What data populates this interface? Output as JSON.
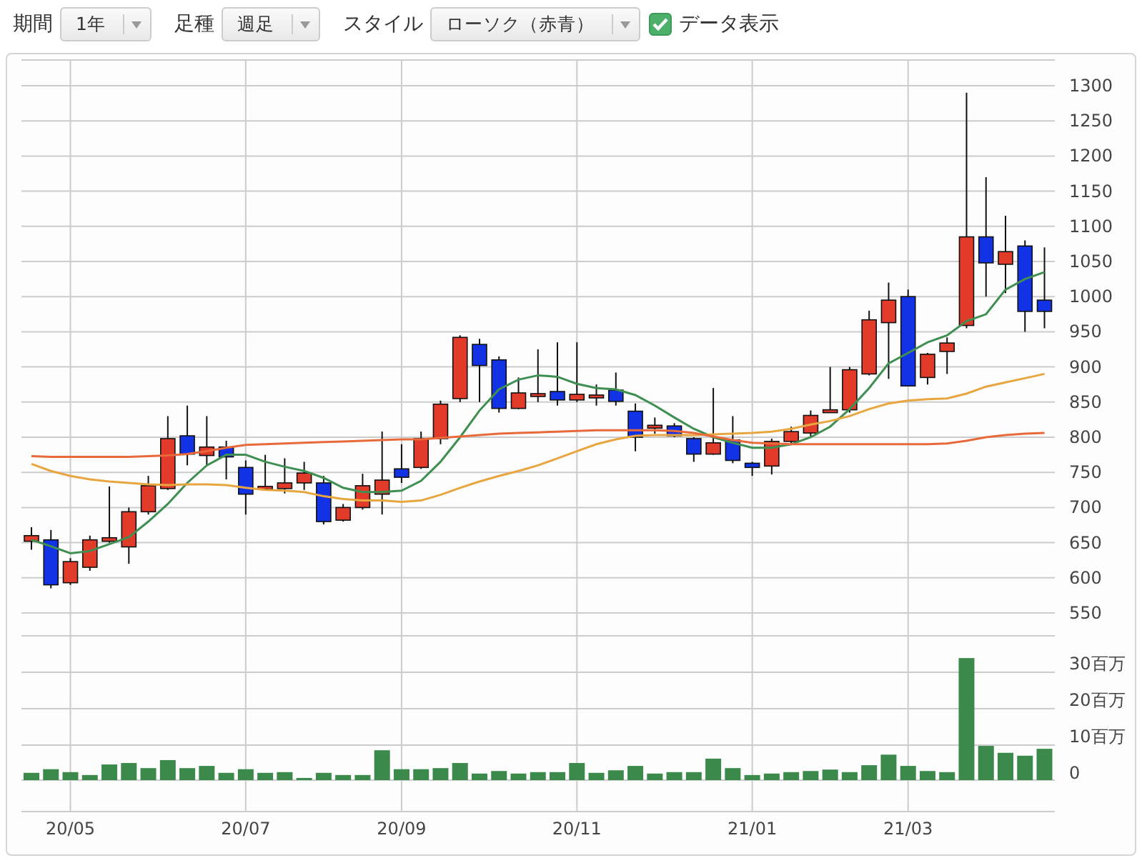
{
  "toolbar": [
    {
      "kind": "dropdown",
      "label": "期間",
      "value": "1年"
    },
    {
      "kind": "dropdown",
      "label": "足種",
      "value": "週足"
    },
    {
      "kind": "dropdown",
      "label": "スタイル",
      "value": "ローソク（赤青）"
    },
    {
      "kind": "checkbox",
      "label": "データ表示",
      "checked": true
    }
  ],
  "price_chart": {
    "chart_data": {
      "type": "candlestick",
      "grid": true,
      "ylim": [
        550,
        1300
      ],
      "yticks": [
        550,
        600,
        650,
        700,
        750,
        800,
        850,
        900,
        950,
        1000,
        1050,
        1100,
        1150,
        1200,
        1250,
        1300
      ],
      "ohlc": [
        [
          652,
          672,
          640,
          660
        ],
        [
          654,
          668,
          585,
          590
        ],
        [
          593,
          628,
          590,
          623
        ],
        [
          615,
          660,
          610,
          654
        ],
        [
          652,
          730,
          650,
          657
        ],
        [
          644,
          700,
          620,
          694
        ],
        [
          694,
          745,
          690,
          731
        ],
        [
          727,
          830,
          725,
          798
        ],
        [
          802,
          845,
          760,
          776
        ],
        [
          774,
          830,
          760,
          786
        ],
        [
          786,
          795,
          740,
          772
        ],
        [
          757,
          767,
          690,
          719
        ],
        [
          728,
          775,
          725,
          730
        ],
        [
          727,
          770,
          720,
          735
        ],
        [
          735,
          765,
          725,
          749
        ],
        [
          735,
          745,
          676,
          680
        ],
        [
          682,
          705,
          680,
          700
        ],
        [
          700,
          748,
          697,
          731
        ],
        [
          719,
          808,
          690,
          739
        ],
        [
          755,
          790,
          735,
          743
        ],
        [
          757,
          808,
          755,
          798
        ],
        [
          798,
          852,
          790,
          847
        ],
        [
          855,
          945,
          850,
          942
        ],
        [
          932,
          940,
          850,
          902
        ],
        [
          910,
          915,
          835,
          841
        ],
        [
          841,
          885,
          840,
          863
        ],
        [
          860,
          925,
          850,
          862
        ],
        [
          865,
          935,
          845,
          853
        ],
        [
          853,
          935,
          850,
          861
        ],
        [
          858,
          875,
          845,
          860
        ],
        [
          867,
          892,
          845,
          851
        ],
        [
          837,
          848,
          780,
          800
        ],
        [
          815,
          828,
          805,
          817
        ],
        [
          816,
          820,
          800,
          802
        ],
        [
          798,
          800,
          765,
          776
        ],
        [
          776,
          870,
          775,
          792
        ],
        [
          796,
          830,
          763,
          767
        ],
        [
          763,
          765,
          745,
          757
        ],
        [
          759,
          798,
          747,
          794
        ],
        [
          794,
          815,
          790,
          808
        ],
        [
          806,
          838,
          800,
          831
        ],
        [
          836,
          900,
          835,
          839
        ],
        [
          839,
          900,
          835,
          896
        ],
        [
          890,
          980,
          888,
          967
        ],
        [
          963,
          1020,
          883,
          995
        ],
        [
          1000,
          1010,
          873,
          873
        ],
        [
          885,
          920,
          875,
          918
        ],
        [
          922,
          942,
          890,
          934
        ],
        [
          959,
          1290,
          955,
          1085
        ],
        [
          1085,
          1170,
          1000,
          1048
        ],
        [
          1046,
          1115,
          1005,
          1064
        ],
        [
          1072,
          1080,
          950,
          979
        ],
        [
          995,
          1070,
          955,
          979
        ]
      ]
    }
  },
  "moving_averages": {
    "chart_data": {
      "type": "line",
      "ylim": [
        550,
        1300
      ],
      "series": [
        {
          "color": "#3f8f52",
          "values": [
            654,
            645,
            635,
            638,
            648,
            658,
            680,
            705,
            735,
            760,
            775,
            775,
            765,
            758,
            752,
            742,
            728,
            722,
            722,
            724,
            738,
            765,
            800,
            838,
            868,
            882,
            888,
            886,
            876,
            870,
            868,
            860,
            845,
            828,
            812,
            800,
            792,
            785,
            785,
            790,
            800,
            815,
            840,
            870,
            905,
            920,
            935,
            945,
            965,
            975,
            1010,
            1025,
            1035
          ]
        },
        {
          "color": "#e8a640",
          "values": [
            762,
            752,
            745,
            740,
            737,
            735,
            733,
            732,
            733,
            733,
            732,
            728,
            725,
            724,
            722,
            716,
            712,
            710,
            710,
            708,
            710,
            718,
            728,
            737,
            745,
            752,
            760,
            770,
            780,
            790,
            797,
            802,
            803,
            803,
            803,
            804,
            805,
            806,
            808,
            812,
            818,
            823,
            830,
            840,
            848,
            852,
            854,
            855,
            862,
            872,
            878,
            884,
            890
          ]
        },
        {
          "color": "#e86a3a",
          "values": [
            773,
            772,
            772,
            772,
            772,
            772,
            773,
            774,
            776,
            780,
            785,
            789,
            790,
            791,
            792,
            793,
            794,
            795,
            796,
            797,
            797,
            799,
            801,
            803,
            805,
            806,
            807,
            808,
            809,
            810,
            810,
            810,
            810,
            809,
            806,
            801,
            796,
            792,
            791,
            790,
            790,
            790,
            790,
            790,
            790,
            790,
            790,
            791,
            795,
            800,
            803,
            805,
            806
          ]
        }
      ]
    }
  },
  "volume_chart": {
    "chart_data": {
      "type": "bar",
      "grid": true,
      "categories": [
        null,
        null,
        "20/05",
        null,
        null,
        null,
        null,
        null,
        null,
        null,
        null,
        "20/07",
        null,
        null,
        null,
        null,
        null,
        null,
        null,
        "20/09",
        null,
        null,
        null,
        null,
        null,
        null,
        null,
        null,
        "20/11",
        null,
        null,
        null,
        null,
        null,
        null,
        null,
        null,
        "21/01",
        null,
        null,
        null,
        null,
        null,
        null,
        null,
        "21/03",
        null,
        null,
        null,
        null,
        null,
        null,
        null
      ],
      "ylim": [
        0,
        40
      ],
      "yticks": [
        {
          "value": 0,
          "label": "0"
        },
        {
          "value": 10,
          "label": "10百万"
        },
        {
          "value": 20,
          "label": "20百万"
        },
        {
          "value": 30,
          "label": "30百万"
        }
      ],
      "series": [
        {
          "color": "#3b8a4b",
          "values": [
            2,
            3,
            2.2,
            1.4,
            4.3,
            4.7,
            3.3,
            5.5,
            3.3,
            3.9,
            2,
            3,
            2,
            2.2,
            0.6,
            2,
            1.4,
            1.4,
            8.2,
            3,
            3,
            3.3,
            4.7,
            1.8,
            2.5,
            1.8,
            2.2,
            2.2,
            4.7,
            2,
            2.7,
            3.9,
            1.8,
            2.2,
            2.2,
            5.9,
            3.3,
            1.4,
            1.8,
            2.2,
            2.5,
            2.9,
            2.2,
            4.1,
            7,
            3.9,
            2.5,
            2.2,
            33.5,
            9.4,
            7.5,
            6.7,
            8.6
          ]
        }
      ]
    }
  }
}
